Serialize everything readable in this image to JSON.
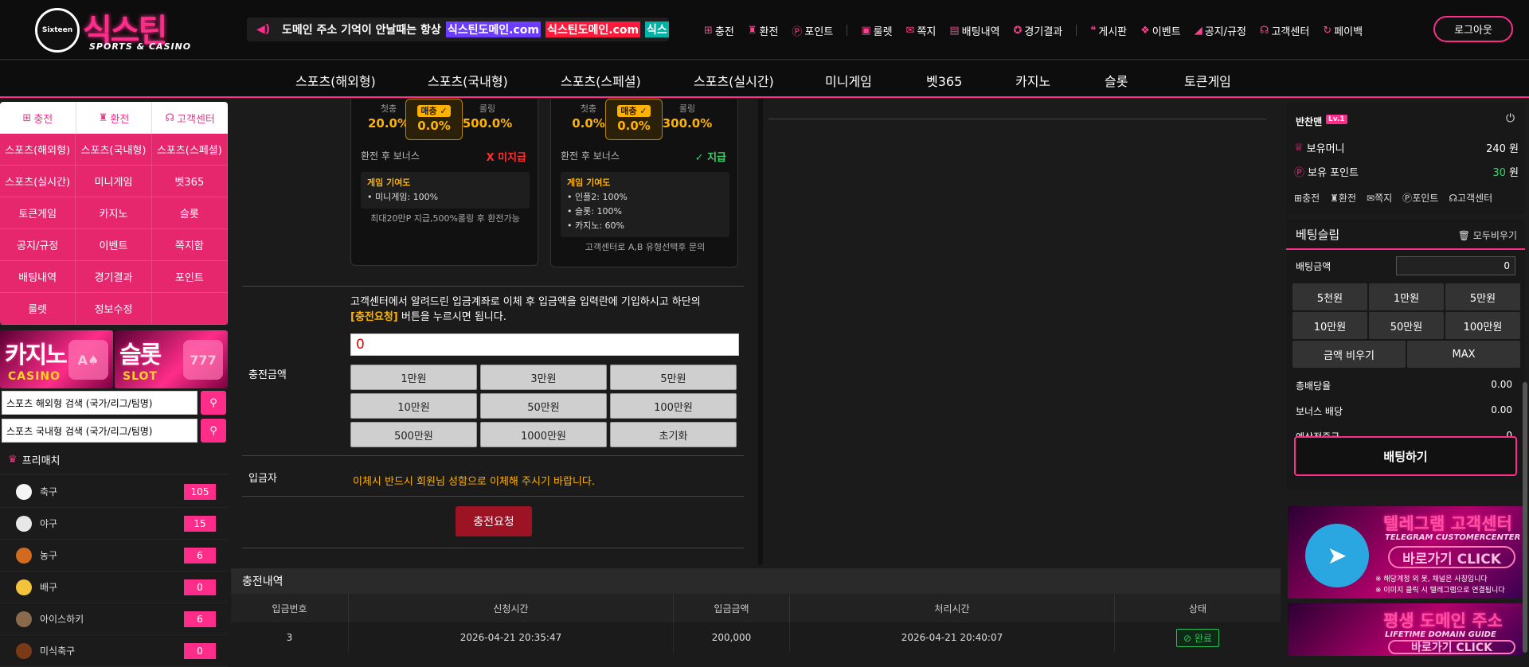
{
  "brand": {
    "mark": "Sixteen",
    "name": "식스틴",
    "tagline": "SPORTS & CASINO"
  },
  "notice": {
    "lead": "도메인 주소 기억이 안날때는 항상",
    "links": [
      "식스틴도메인.com",
      "식스틴도메인.com",
      "식스"
    ]
  },
  "topnav": [
    "충전",
    "환전",
    "포인트",
    "룰렛",
    "쪽지",
    "배팅내역",
    "경기결과",
    "게시판",
    "이벤트",
    "공지/규정",
    "고객센터",
    "페이백"
  ],
  "logout": "로그아웃",
  "mainnav": [
    "스포츠(해외형)",
    "스포츠(국내형)",
    "스포츠(스페셜)",
    "스포츠(실시간)",
    "미니게임",
    "벳365",
    "카지노",
    "슬롯",
    "토큰게임"
  ],
  "left": {
    "tabs": [
      "충전",
      "환전",
      "고객센터"
    ],
    "grid": [
      "스포츠(해외형)",
      "스포츠(국내형)",
      "스포츠(스페셜)",
      "스포츠(실시간)",
      "미니게임",
      "벳365",
      "토큰게임",
      "카지노",
      "슬롯",
      "공지/규정",
      "이벤트",
      "쪽지함",
      "배팅내역",
      "경기결과",
      "포인트",
      "룰렛",
      "정보수정",
      ""
    ],
    "banners": [
      {
        "title": "카지노",
        "sub": "CASINO"
      },
      {
        "title": "슬롯",
        "sub": "SLOT"
      }
    ],
    "search": [
      "스포츠 해외형 검색 (국가/리그/팀명)",
      "스포츠 국내형 검색 (국가/리그/팀명)"
    ],
    "prematch": "프리매치",
    "sports": [
      {
        "name": "축구",
        "count": "105"
      },
      {
        "name": "야구",
        "count": "15"
      },
      {
        "name": "농구",
        "count": "6"
      },
      {
        "name": "배구",
        "count": "0"
      },
      {
        "name": "아이스하키",
        "count": "6"
      },
      {
        "name": "미식축구",
        "count": "0"
      }
    ]
  },
  "cards": [
    {
      "percents": [
        {
          "label": "첫충",
          "value": "20.0%"
        },
        {
          "label": "매충 ✓",
          "value": "0.0%"
        },
        {
          "label": "롤링",
          "value": "500.0%"
        }
      ],
      "bonus_label": "환전 후 보너스",
      "bonus_status": "X 미지급",
      "bonus_color": "#ff3030",
      "contrib_title": "게임 기여도",
      "contrib": [
        "미니게임: 100%"
      ],
      "note": "최대20만P 지급,500%롤링 후 환전가능"
    },
    {
      "percents": [
        {
          "label": "첫충",
          "value": "0.0%"
        },
        {
          "label": "매충 ✓",
          "value": "0.0%"
        },
        {
          "label": "롤링",
          "value": "300.0%"
        }
      ],
      "bonus_label": "환전 후 보너스",
      "bonus_status": "✓ 지급",
      "bonus_color": "#3ad36a",
      "contrib_title": "게임 기여도",
      "contrib": [
        "인플2: 100%",
        "슬롯: 100%",
        "카지노: 60%"
      ],
      "note": "고객센터로 A,B 유형선택후 문의"
    }
  ],
  "deposit": {
    "instruction1": "고객센터에서 알려드린 입금계좌로 이체 후 입금액을 입력란에 기입하시고 하단의",
    "instruction_hl": "[충전요청]",
    "instruction2": " 버튼을 누르시면 됩니다.",
    "amount_label": "충전금액",
    "amount_value": "0",
    "chips": [
      "1만원",
      "3만원",
      "5만원",
      "10만원",
      "50만원",
      "100만원",
      "500만원",
      "1000만원",
      "초기화"
    ],
    "depositor_label": "입금자",
    "depositor_note": "이체시 반드시 회원님 성함으로 이체해 주시기 바랍니다.",
    "submit": "충전요청"
  },
  "history": {
    "title": "충전내역",
    "headers": [
      "입금번호",
      "신청시간",
      "입금금액",
      "처리시간",
      "상태"
    ],
    "rows": [
      {
        "no": "3",
        "req": "2026-04-21 20:35:47",
        "amount": "200,000",
        "done": "2026-04-21 20:40:07",
        "status": "완료"
      }
    ]
  },
  "user": {
    "name": "반찬맨",
    "level": "Lv.1",
    "money_label": "보유머니",
    "money": "240 원",
    "point_label": "보유 포인트",
    "point": "30",
    "point_unit": " 원",
    "links": [
      "충전",
      "환전",
      "쪽지",
      "포인트",
      "고객센터"
    ]
  },
  "slip": {
    "title": "베팅슬립",
    "clear": "모두비우기",
    "amount_label": "배팅금액",
    "amount": "0",
    "chips": [
      "5천원",
      "1만원",
      "5만원",
      "10만원",
      "50만원",
      "100만원"
    ],
    "empty": "금액 비우기",
    "max": "MAX",
    "odds_label": "총배당율",
    "odds": "0.00",
    "bonus_label": "보너스 배당",
    "bonus": "0.00",
    "expect_label": "예상적중금",
    "expect": "0",
    "bet": "배팅하기"
  },
  "promo": [
    {
      "title": "텔레그램 고객센터",
      "sub": "TELEGRAM CUSTOMERCENTER",
      "cta": "바로가기 CLICK",
      "notes": [
        "※ 해당계정 외 봇, 채널은 사칭입니다",
        "※ 이미지 클릭 시 텔레그램으로 연결됩니다"
      ]
    },
    {
      "title": "평생 도메인 주소",
      "sub": "LIFETIME DOMAIN GUIDE",
      "cta": "바로가기 CLICK",
      "notes": []
    }
  ],
  "colors": {
    "accent": "#ff2d8a",
    "gold": "#ffb300",
    "submit": "#9c1424"
  }
}
